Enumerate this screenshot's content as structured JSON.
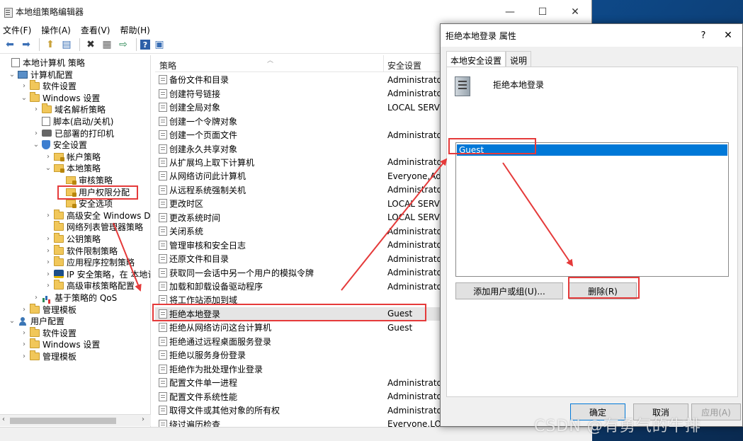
{
  "window": {
    "title": "本地组策略编辑器",
    "controls": [
      "—",
      "☐",
      "✕"
    ]
  },
  "menubar": [
    "文件(F)",
    "操作(A)",
    "查看(V)",
    "帮助(H)"
  ],
  "toolbar": [
    "back-icon",
    "forward-icon",
    "up-icon",
    "show-hide-tree-icon",
    "delete-icon",
    "properties-icon",
    "export-icon",
    "help-icon",
    "view-icon"
  ],
  "tree": [
    {
      "label": "本地计算机 策略",
      "indent": 0,
      "icon": "policy-doc",
      "chev": ""
    },
    {
      "label": "计算机配置",
      "indent": 1,
      "icon": "computer",
      "chev": "⌄"
    },
    {
      "label": "软件设置",
      "indent": 2,
      "icon": "folder",
      "chev": "›"
    },
    {
      "label": "Windows 设置",
      "indent": 2,
      "icon": "folder",
      "chev": "⌄"
    },
    {
      "label": "域名解析策略",
      "indent": 3,
      "icon": "folder",
      "chev": "›"
    },
    {
      "label": "脚本(启动/关机)",
      "indent": 3,
      "icon": "doc",
      "chev": ""
    },
    {
      "label": "已部署的打印机",
      "indent": 3,
      "icon": "printer",
      "chev": "›"
    },
    {
      "label": "安全设置",
      "indent": 3,
      "icon": "shield",
      "chev": "⌄"
    },
    {
      "label": "帐户策略",
      "indent": 4,
      "icon": "lockfolder",
      "chev": "›"
    },
    {
      "label": "本地策略",
      "indent": 4,
      "icon": "lockfolder",
      "chev": "⌄"
    },
    {
      "label": "审核策略",
      "indent": 5,
      "icon": "lockfolder",
      "chev": ""
    },
    {
      "label": "用户权限分配",
      "indent": 5,
      "icon": "lockfolder",
      "chev": "",
      "selected": true
    },
    {
      "label": "安全选项",
      "indent": 5,
      "icon": "lockfolder",
      "chev": ""
    },
    {
      "label": "高级安全 Windows Defe",
      "indent": 4,
      "icon": "folder",
      "chev": "›"
    },
    {
      "label": "网络列表管理器策略",
      "indent": 4,
      "icon": "folder",
      "chev": ""
    },
    {
      "label": "公钥策略",
      "indent": 4,
      "icon": "folder",
      "chev": "›"
    },
    {
      "label": "软件限制策略",
      "indent": 4,
      "icon": "folder",
      "chev": "›"
    },
    {
      "label": "应用程序控制策略",
      "indent": 4,
      "icon": "folder",
      "chev": "›"
    },
    {
      "label": "IP 安全策略，在 本地计算",
      "indent": 4,
      "icon": "ipsec",
      "chev": "›"
    },
    {
      "label": "高级审核策略配置",
      "indent": 4,
      "icon": "folder",
      "chev": "›"
    },
    {
      "label": "基于策略的 QoS",
      "indent": 3,
      "icon": "chart",
      "chev": "›"
    },
    {
      "label": "管理模板",
      "indent": 2,
      "icon": "folder",
      "chev": "›"
    },
    {
      "label": "用户配置",
      "indent": 1,
      "icon": "user",
      "chev": "⌄"
    },
    {
      "label": "软件设置",
      "indent": 2,
      "icon": "folder",
      "chev": "›"
    },
    {
      "label": "Windows 设置",
      "indent": 2,
      "icon": "folder",
      "chev": "›"
    },
    {
      "label": "管理模板",
      "indent": 2,
      "icon": "folder",
      "chev": "›"
    }
  ],
  "list": {
    "columns": [
      "策略",
      "安全设置"
    ],
    "rows": [
      {
        "policy": "备份文件和目录",
        "setting": "Administrators"
      },
      {
        "policy": "创建符号链接",
        "setting": "Administrators"
      },
      {
        "policy": "创建全局对象",
        "setting": "LOCAL SERVIC"
      },
      {
        "policy": "创建一个令牌对象",
        "setting": ""
      },
      {
        "policy": "创建一个页面文件",
        "setting": "Administrators"
      },
      {
        "policy": "创建永久共享对象",
        "setting": ""
      },
      {
        "policy": "从扩展坞上取下计算机",
        "setting": "Administrators"
      },
      {
        "policy": "从网络访问此计算机",
        "setting": "Everyone,Ad"
      },
      {
        "policy": "从远程系统强制关机",
        "setting": "Administrators"
      },
      {
        "policy": "更改时区",
        "setting": "LOCAL SERVIC"
      },
      {
        "policy": "更改系统时间",
        "setting": "LOCAL SERVIC"
      },
      {
        "policy": "关闭系统",
        "setting": "Administrators"
      },
      {
        "policy": "管理审核和安全日志",
        "setting": "Administrators"
      },
      {
        "policy": "还原文件和目录",
        "setting": "Administrators"
      },
      {
        "policy": "获取同一会话中另一个用户的模拟令牌",
        "setting": "Administrators"
      },
      {
        "policy": "加载和卸载设备驱动程序",
        "setting": "Administrators"
      },
      {
        "policy": "将工作站添加到域",
        "setting": ""
      },
      {
        "policy": "拒绝本地登录",
        "setting": "Guest",
        "selected": true
      },
      {
        "policy": "拒绝从网络访问这台计算机",
        "setting": "Guest"
      },
      {
        "policy": "拒绝通过远程桌面服务登录",
        "setting": ""
      },
      {
        "policy": "拒绝以服务身份登录",
        "setting": ""
      },
      {
        "policy": "拒绝作为批处理作业登录",
        "setting": ""
      },
      {
        "policy": "配置文件单一进程",
        "setting": "Administrators"
      },
      {
        "policy": "配置文件系统性能",
        "setting": "Administrators"
      },
      {
        "policy": "取得文件或其他对象的所有权",
        "setting": "Administrators"
      },
      {
        "policy": "绕过遍历检查",
        "setting": "Everyone,LOCA"
      }
    ]
  },
  "dialog": {
    "title": "拒绝本地登录 属性",
    "help": "?",
    "close": "✕",
    "tabs": [
      "本地安全设置",
      "说明"
    ],
    "heading": "拒绝本地登录",
    "members": [
      "Guest"
    ],
    "add_button": "添加用户或组(U)...",
    "remove_button": "删除(R)",
    "ok": "确定",
    "cancel": "取消",
    "apply": "应用(A)"
  },
  "watermark": "CSDN @有勇气的牛排",
  "annotation_color": "#e53a3a"
}
